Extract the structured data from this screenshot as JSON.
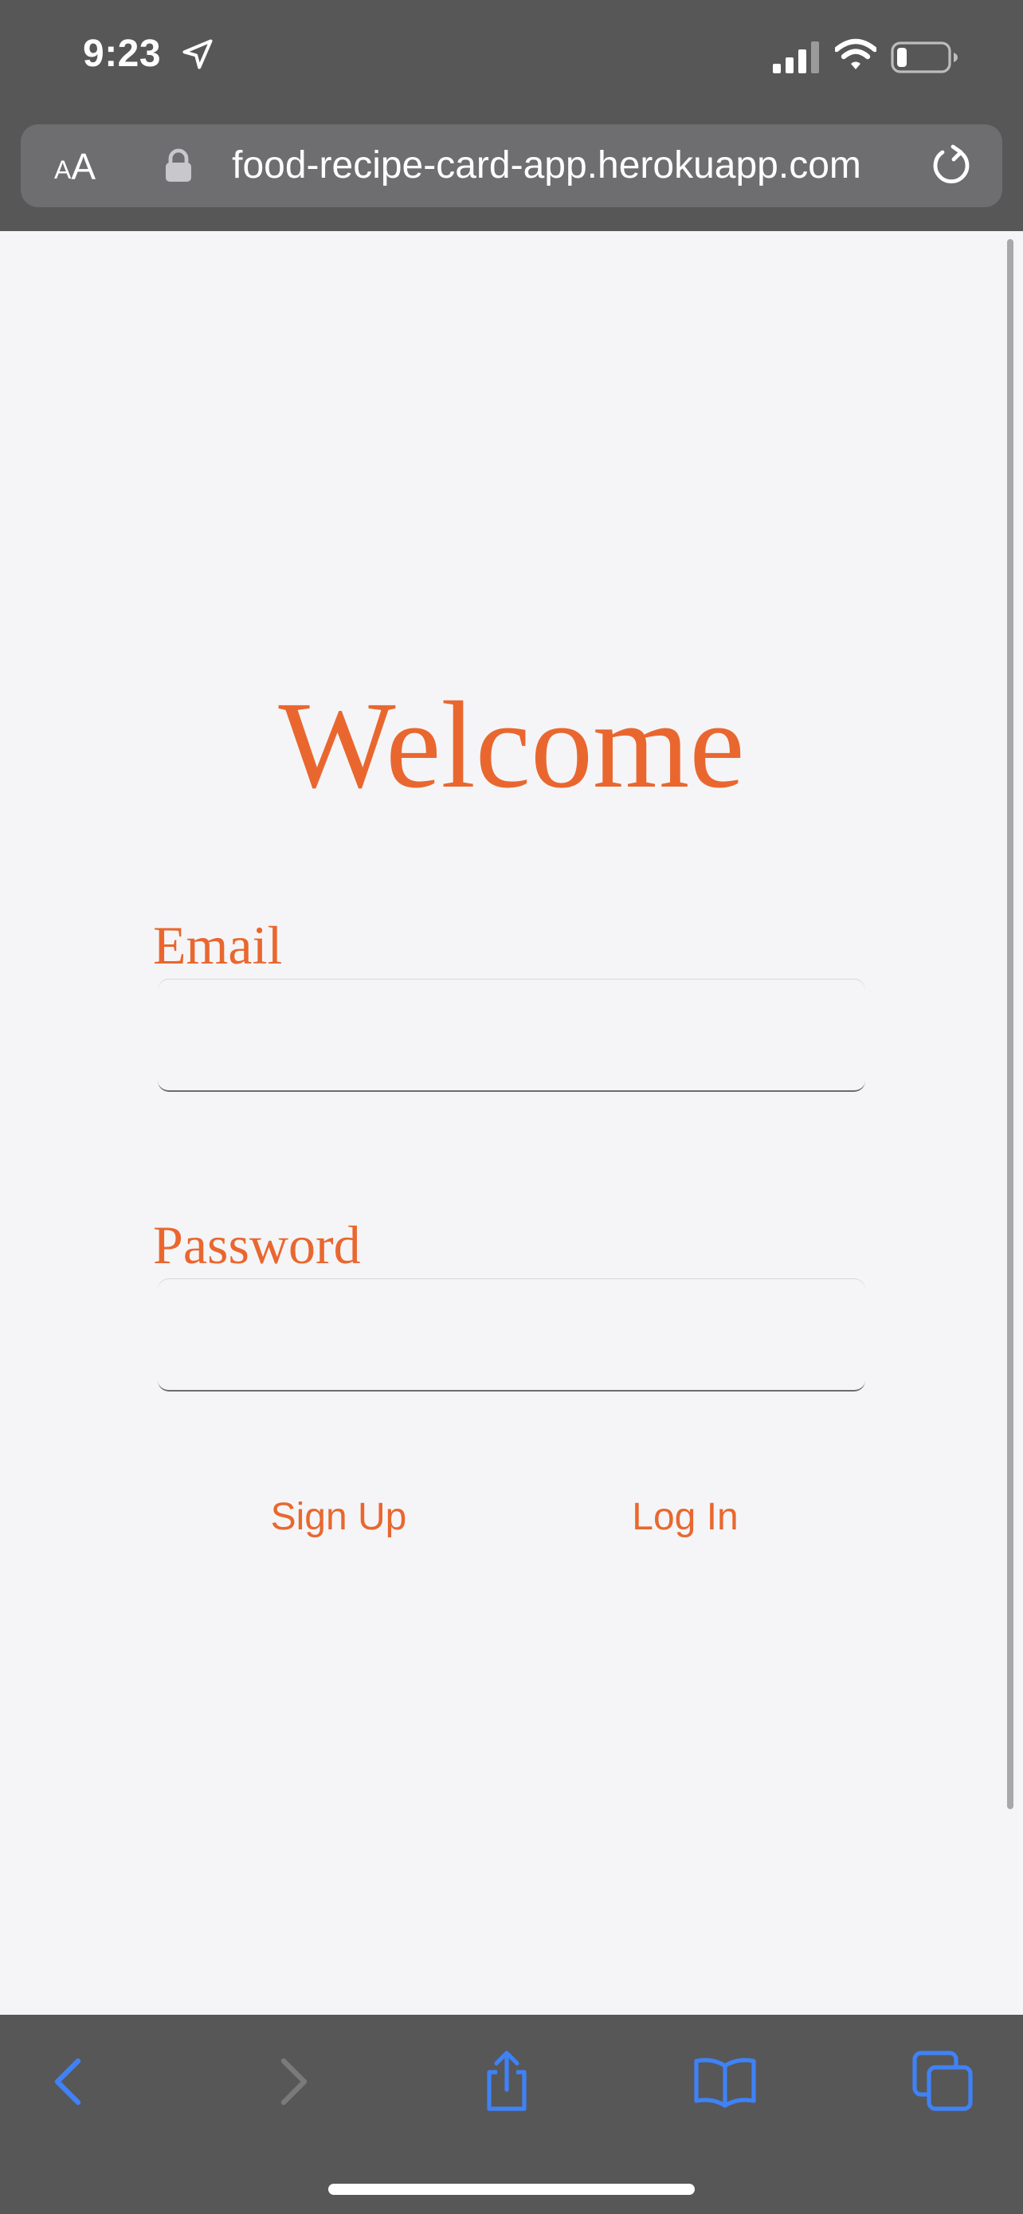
{
  "status_bar": {
    "time": "9:23",
    "icons": [
      "location-arrow-icon",
      "cellular-signal-icon",
      "wifi-icon",
      "battery-low-icon"
    ]
  },
  "browser": {
    "text_size_small": "A",
    "text_size_large": "A",
    "url": "food-recipe-card-app.herokuapp.com",
    "icons": [
      "lock-icon",
      "reload-icon"
    ]
  },
  "page": {
    "title": "Welcome",
    "email": {
      "label": "Email",
      "value": "",
      "placeholder": ""
    },
    "password": {
      "label": "Password",
      "value": "",
      "placeholder": ""
    },
    "signup_label": "Sign Up",
    "login_label": "Log In"
  },
  "toolbar": {
    "icons": [
      "back-icon",
      "forward-icon",
      "share-icon",
      "bookmarks-icon",
      "tabs-icon"
    ]
  },
  "colors": {
    "accent": "#e9672f",
    "chrome": "#575757",
    "url_bar": "#6e6e70",
    "toolbar_icon": "#3f82f7",
    "toolbar_icon_disabled": "#7a7a7c",
    "page_background": "#f5f5f7"
  }
}
